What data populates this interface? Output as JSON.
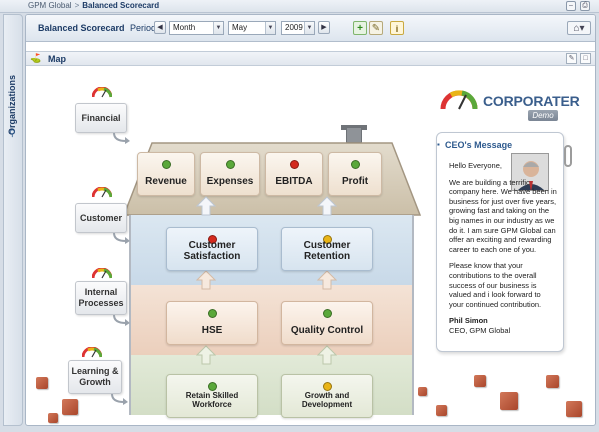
{
  "breadcrumb": {
    "root": "GPM Global",
    "separator": ">",
    "current": "Balanced Scorecard"
  },
  "sidebar": {
    "tab_label": "Organizations"
  },
  "toolbar": {
    "title": "Balanced Scorecard",
    "period_label": "Period:",
    "prev_button": "◀",
    "next_button": "▶",
    "period_select": "Month",
    "month_select": "May",
    "year_select": "2009",
    "add_icon": "plus-icon",
    "edit_icon": "pencil-icon",
    "info_icon": "info-icon",
    "home_icon": "home-icon"
  },
  "map_panel": {
    "label": "Map"
  },
  "perspectives": [
    {
      "label": "Financial",
      "gauge": "green"
    },
    {
      "label": "Customer",
      "gauge": "green"
    },
    {
      "label": "Internal Processes",
      "gauge": "green"
    },
    {
      "label": "Learning & Growth",
      "gauge": "green"
    }
  ],
  "objectives": {
    "financial": [
      {
        "label": "Revenue",
        "status": "green"
      },
      {
        "label": "Expenses",
        "status": "green"
      },
      {
        "label": "EBITDA",
        "status": "red"
      },
      {
        "label": "Profit",
        "status": "green"
      }
    ],
    "customer": [
      {
        "label": "Customer Satisfaction",
        "status": "red"
      },
      {
        "label": "Customer Retention",
        "status": "yellow"
      }
    ],
    "internal": [
      {
        "label": "HSE",
        "status": "green"
      },
      {
        "label": "Quality Control",
        "status": "green"
      }
    ],
    "learning": [
      {
        "label": "Retain Skilled Workforce",
        "status": "green"
      },
      {
        "label": "Growth and Development",
        "status": "yellow"
      }
    ]
  },
  "logo": {
    "word": "CORPORATER",
    "badge": "Demo"
  },
  "ceo_message": {
    "title": "CEO's Message",
    "greeting": "Hello Everyone,",
    "para1": "We are building a terrific company here. We have been in business for just over five years, growing fast and taking on the big names in our industry as we do it.  I am sure GPM Global can offer an exciting and rewarding career to each one of you.",
    "para2": "Please know that your contributions to the overall success of our business is valued and i look forward to your continued contribution.",
    "signature_name": "Phil Simon",
    "signature_title": "CEO, GPM Global"
  },
  "colors": {
    "status_green": "#5aa83a",
    "status_red": "#d42a1e",
    "status_yellow": "#e9b417",
    "accent": "#1c3b66"
  }
}
